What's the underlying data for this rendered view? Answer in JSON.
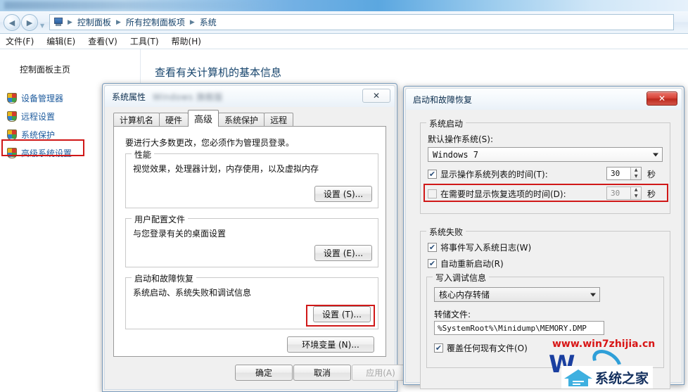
{
  "explorer": {
    "breadcrumb": [
      "控制面板",
      "所有控制面板项",
      "系统"
    ],
    "separator": "▶",
    "nav": {
      "back": "◀",
      "forward": "▶",
      "chevron": "▼"
    },
    "menus": [
      "文件(F)",
      "编辑(E)",
      "查看(V)",
      "工具(T)",
      "帮助(H)"
    ],
    "sidebar": {
      "home": "控制面板主页",
      "items": [
        {
          "label": "设备管理器"
        },
        {
          "label": "远程设置"
        },
        {
          "label": "系统保护"
        },
        {
          "label": "高级系统设置"
        }
      ]
    },
    "main_heading": "查看有关计算机的基本信息"
  },
  "sysprops": {
    "title": "系统属性",
    "title_blur": "Windows 旗舰版",
    "close": "✕",
    "tabs": [
      {
        "label": "计算机名"
      },
      {
        "label": "硬件"
      },
      {
        "label": "高级"
      },
      {
        "label": "系统保护"
      },
      {
        "label": "远程"
      }
    ],
    "active_tab": 2,
    "note": "要进行大多数更改，您必须作为管理员登录。",
    "groups": [
      {
        "title": "性能",
        "desc": "视觉效果，处理器计划，内存使用，以及虚拟内存",
        "button": "设置 (S)..."
      },
      {
        "title": "用户配置文件",
        "desc": "与您登录有关的桌面设置",
        "button": "设置 (E)..."
      },
      {
        "title": "启动和故障恢复",
        "desc": "系统启动、系统失败和调试信息",
        "button": "设置 (T)..."
      }
    ],
    "env_button": "环境变量 (N)...",
    "ok": "确定",
    "cancel": "取消",
    "apply": "应用(A)"
  },
  "startup": {
    "title": "启动和故障恢复",
    "close": "✕",
    "boot_group": "系统启动",
    "default_os_label": "默认操作系统(S):",
    "default_os_value": "Windows 7",
    "show_list_label": "显示操作系统列表的时间(T):",
    "show_list_value": "30",
    "show_list_checked": true,
    "show_recovery_label": "在需要时显示恢复选项的时间(D):",
    "show_recovery_value": "30",
    "show_recovery_checked": false,
    "unit": "秒",
    "fail_group": "系统失败",
    "write_event_label": "将事件写入系统日志(W)",
    "write_event_checked": true,
    "auto_restart_label": "自动重新启动(R)",
    "auto_restart_checked": true,
    "debug_group": "写入调试信息",
    "debug_value": "核心内存转储",
    "dump_file_label": "转储文件:",
    "dump_file_value": "%SystemRoot%\\Minidump\\MEMORY.DMP",
    "overwrite_label": "覆盖任何现有文件(O)",
    "overwrite_checked": true
  },
  "watermark": {
    "url": "www.win7zhijia.cn",
    "logo_letter": "W",
    "logo_text": "系统之家"
  },
  "colors": {
    "highlight": "#d01818",
    "accent": "#1f5c9e",
    "watermark_red": "#d81616"
  }
}
